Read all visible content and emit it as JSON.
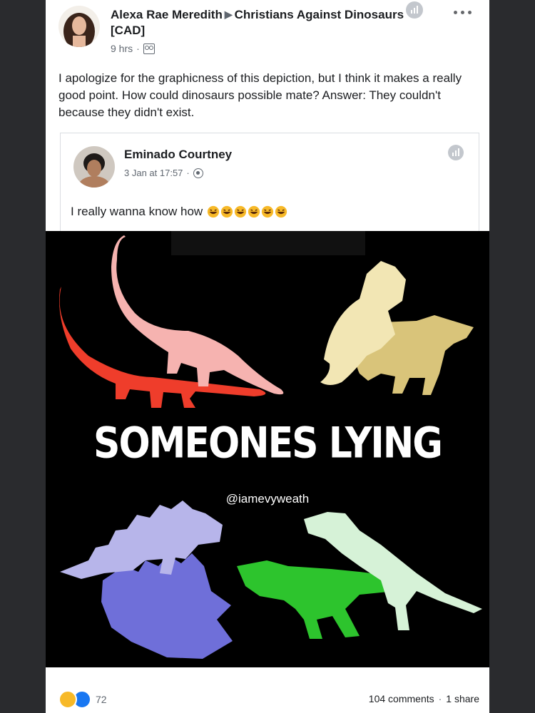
{
  "post": {
    "author": "Alexa Rae Meredith",
    "group": "Christians Against Dinosaurs [CAD]",
    "time": "9 hrs",
    "text": "I apologize for the graphicness of this depiction, but I think it makes a really good point. How could dinosaurs possible mate? Answer: They couldn't because they didn't exist."
  },
  "shared": {
    "author": "Eminado Courtney",
    "time": "3 Jan at 17:57",
    "text": "I really wanna know how"
  },
  "meme": {
    "title": "SOMEONES LYING",
    "handle": "@iamevyweath",
    "colors": {
      "red": "#ef3d2b",
      "pink": "#f6b3b0",
      "cream": "#f2e6b4",
      "tan": "#d9c47a",
      "lavender": "#b7b5ea",
      "indigo": "#6f6fd9",
      "mint": "#d6f2d7",
      "green": "#2dc42d"
    }
  },
  "footer": {
    "reaction_count": "72",
    "comments": "104 comments",
    "shares": "1 share"
  }
}
